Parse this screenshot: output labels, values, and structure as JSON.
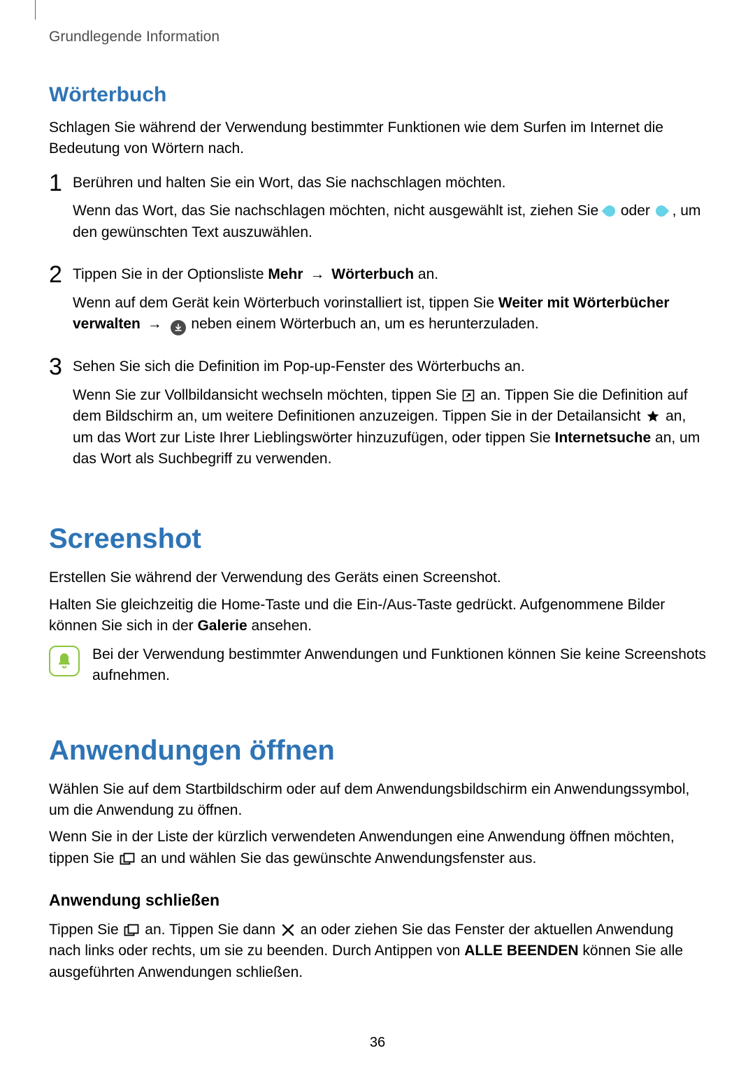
{
  "header": {
    "breadcrumb": "Grundlegende Information"
  },
  "sections": {
    "dict": {
      "title": "Wörterbuch",
      "intro": "Schlagen Sie während der Verwendung bestimmter Funktionen wie dem Surfen im Internet die Bedeutung von Wörtern nach.",
      "steps": {
        "s1": {
          "num": "1",
          "lead": "Berühren und halten Sie ein Wort, das Sie nachschlagen möchten.",
          "sub_a": "Wenn das Wort, das Sie nachschlagen möchten, nicht ausgewählt ist, ziehen Sie ",
          "sub_b": " oder ",
          "sub_c": ", um den gewünschten Text auszuwählen."
        },
        "s2": {
          "num": "2",
          "lead_pre": "Tippen Sie in der Optionsliste ",
          "mehr": "Mehr",
          "arrow": "→",
          "worterbuch": "Wörterbuch",
          "lead_post": " an.",
          "sub_a": "Wenn auf dem Gerät kein Wörterbuch vorinstalliert ist, tippen Sie ",
          "weiter_b": "Weiter mit Wörterbücher verwalten",
          "sub_b": " neben einem Wörterbuch an, um es herunterzuladen."
        },
        "s3": {
          "num": "3",
          "lead": "Sehen Sie sich die Definition im Pop-up-Fenster des Wörterbuchs an.",
          "sub_a": "Wenn Sie zur Vollbildansicht wechseln möchten, tippen Sie ",
          "sub_b": " an. Tippen Sie die Definition auf dem Bildschirm an, um weitere Definitionen anzuzeigen. Tippen Sie in der Detailansicht ",
          "sub_c": " an, um das Wort zur Liste Ihrer Lieblingswörter hinzuzufügen, oder tippen Sie ",
          "internetsuche_b": "Internetsuche",
          "sub_d": " an, um das Wort als Suchbegriff zu verwenden."
        }
      }
    },
    "screenshot": {
      "title": "Screenshot",
      "p1": "Erstellen Sie während der Verwendung des Geräts einen Screenshot.",
      "p2_a": "Halten Sie gleichzeitig die Home-Taste und die Ein-/Aus-Taste gedrückt. Aufgenommene Bilder können Sie sich in der ",
      "p2_b_bold": "Galerie",
      "p2_c": " ansehen.",
      "note": "Bei der Verwendung bestimmter Anwendungen und Funktionen können Sie keine Screenshots aufnehmen."
    },
    "apps": {
      "title": "Anwendungen öffnen",
      "p1": "Wählen Sie auf dem Startbildschirm oder auf dem Anwendungsbildschirm ein Anwendungssymbol, um die Anwendung zu öffnen.",
      "p2_a": "Wenn Sie in der Liste der kürzlich verwendeten Anwendungen eine Anwendung öffnen möchten, tippen Sie ",
      "p2_b": " an und wählen Sie das gewünschte Anwendungsfenster aus.",
      "close_h": "Anwendung schließen",
      "p3_a": "Tippen Sie ",
      "p3_b": " an. Tippen Sie dann ",
      "p3_c": " an oder ziehen Sie das Fenster der aktuellen Anwendung nach links oder rechts, um sie zu beenden. Durch Antippen von ",
      "p3_bold": "ALLE BEENDEN",
      "p3_d": " können Sie alle ausgeführten Anwendungen schließen."
    }
  },
  "page_number": "36"
}
